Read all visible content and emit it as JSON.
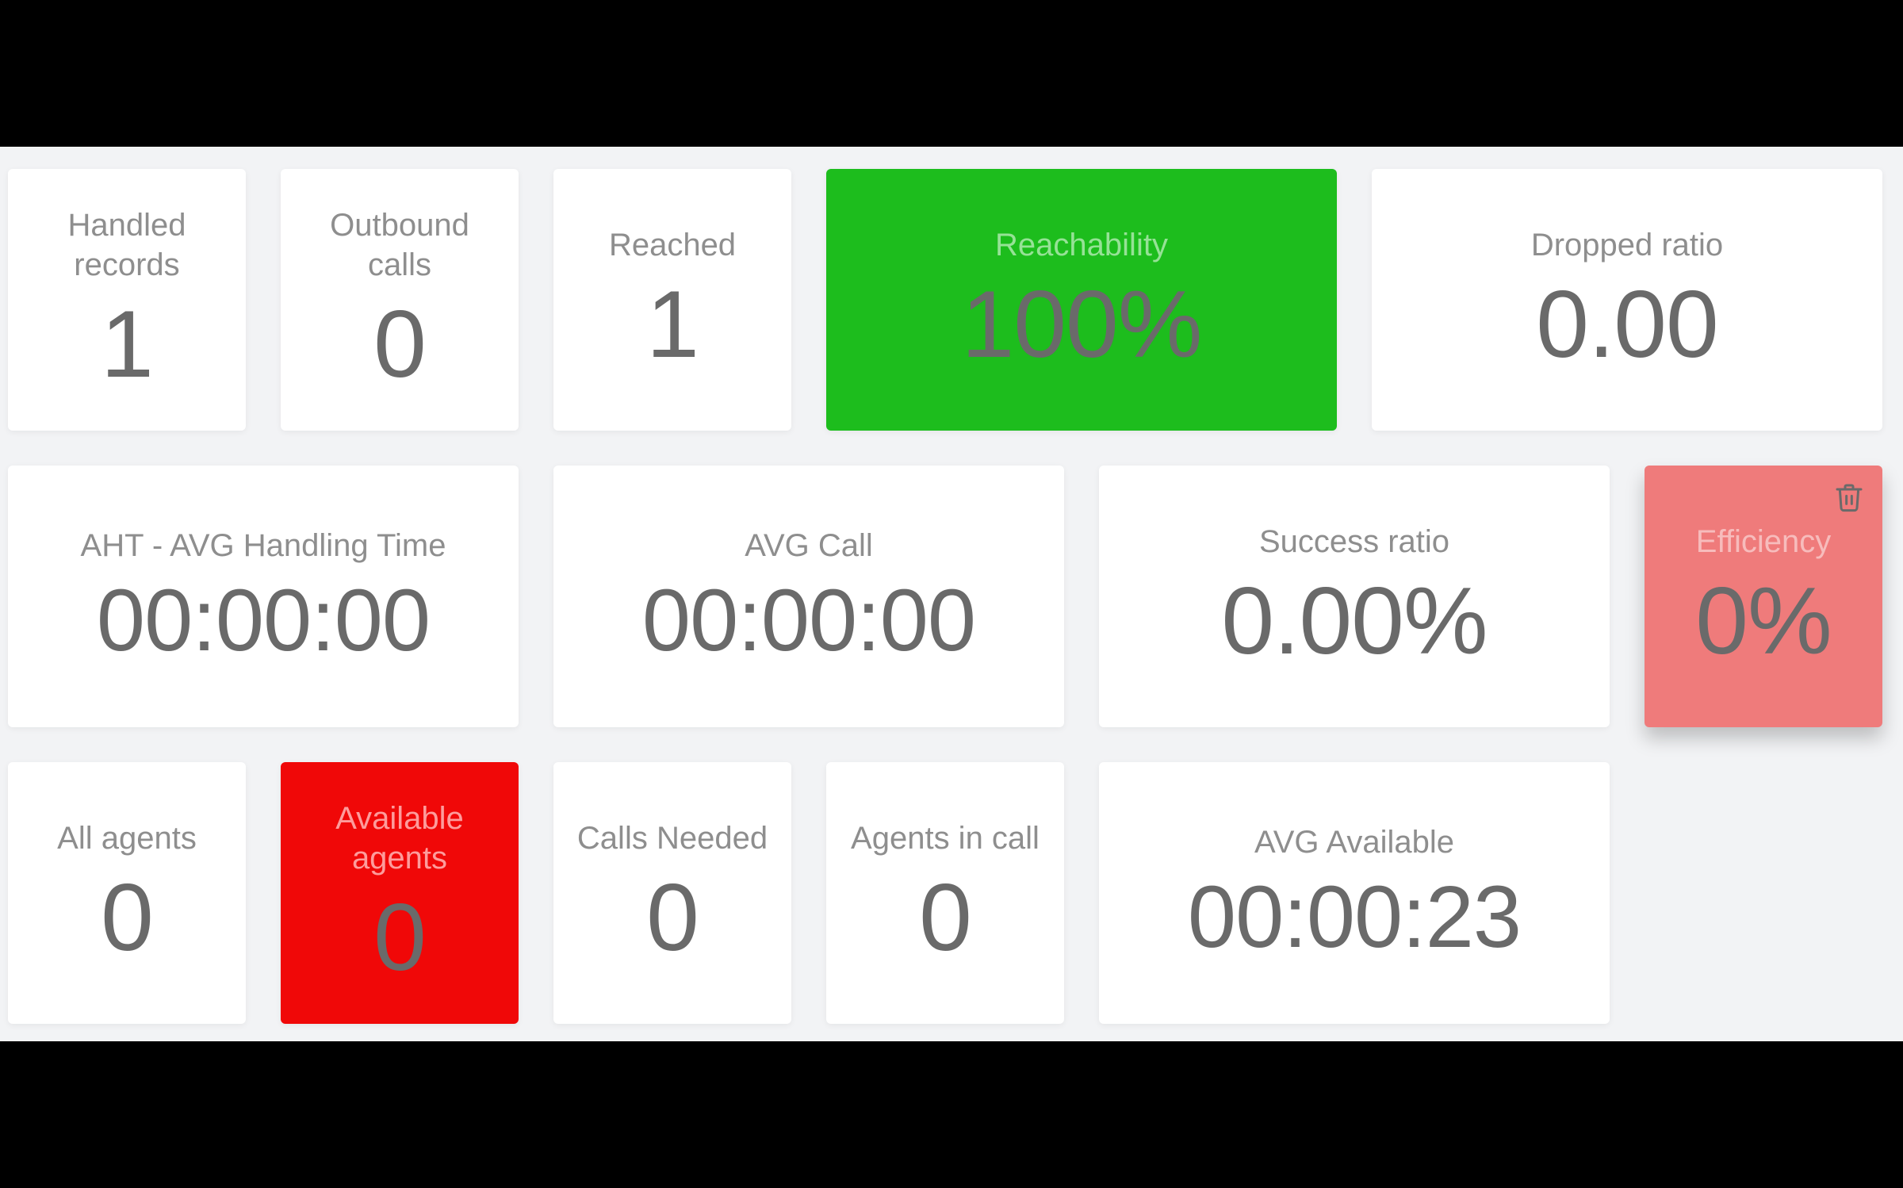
{
  "cards": {
    "handled_records": {
      "title": "Handled records",
      "value": "1"
    },
    "outbound_calls": {
      "title": "Outbound calls",
      "value": "0"
    },
    "reached": {
      "title": "Reached",
      "value": "1"
    },
    "reachability": {
      "title": "Reachability",
      "value": "100%"
    },
    "dropped_ratio": {
      "title": "Dropped ratio",
      "value": "0.00"
    },
    "aht": {
      "title": "AHT - AVG Handling Time",
      "value": "00:00:00"
    },
    "avg_call": {
      "title": "AVG Call",
      "value": "00:00:00"
    },
    "success_ratio": {
      "title": "Success ratio",
      "value": "0.00%"
    },
    "efficiency": {
      "title": "Efficiency",
      "value": "0%"
    },
    "all_agents": {
      "title": "All agents",
      "value": "0"
    },
    "available_agents": {
      "title": "Available agents",
      "value": "0"
    },
    "calls_needed": {
      "title": "Calls Needed",
      "value": "0"
    },
    "agents_in_call": {
      "title": "Agents in call",
      "value": "0"
    },
    "avg_available": {
      "title": "AVG Available",
      "value": "00:00:23"
    }
  },
  "colors": {
    "card_bg": "#ffffff",
    "page_bg": "#f2f3f5",
    "green": "#1dbd1d",
    "red": "#f00808",
    "light_red": "#ef7b7b",
    "title_grey": "#8e8e8e",
    "value_grey": "#6a6a6a"
  },
  "icons": {
    "trash": "trash-icon"
  }
}
